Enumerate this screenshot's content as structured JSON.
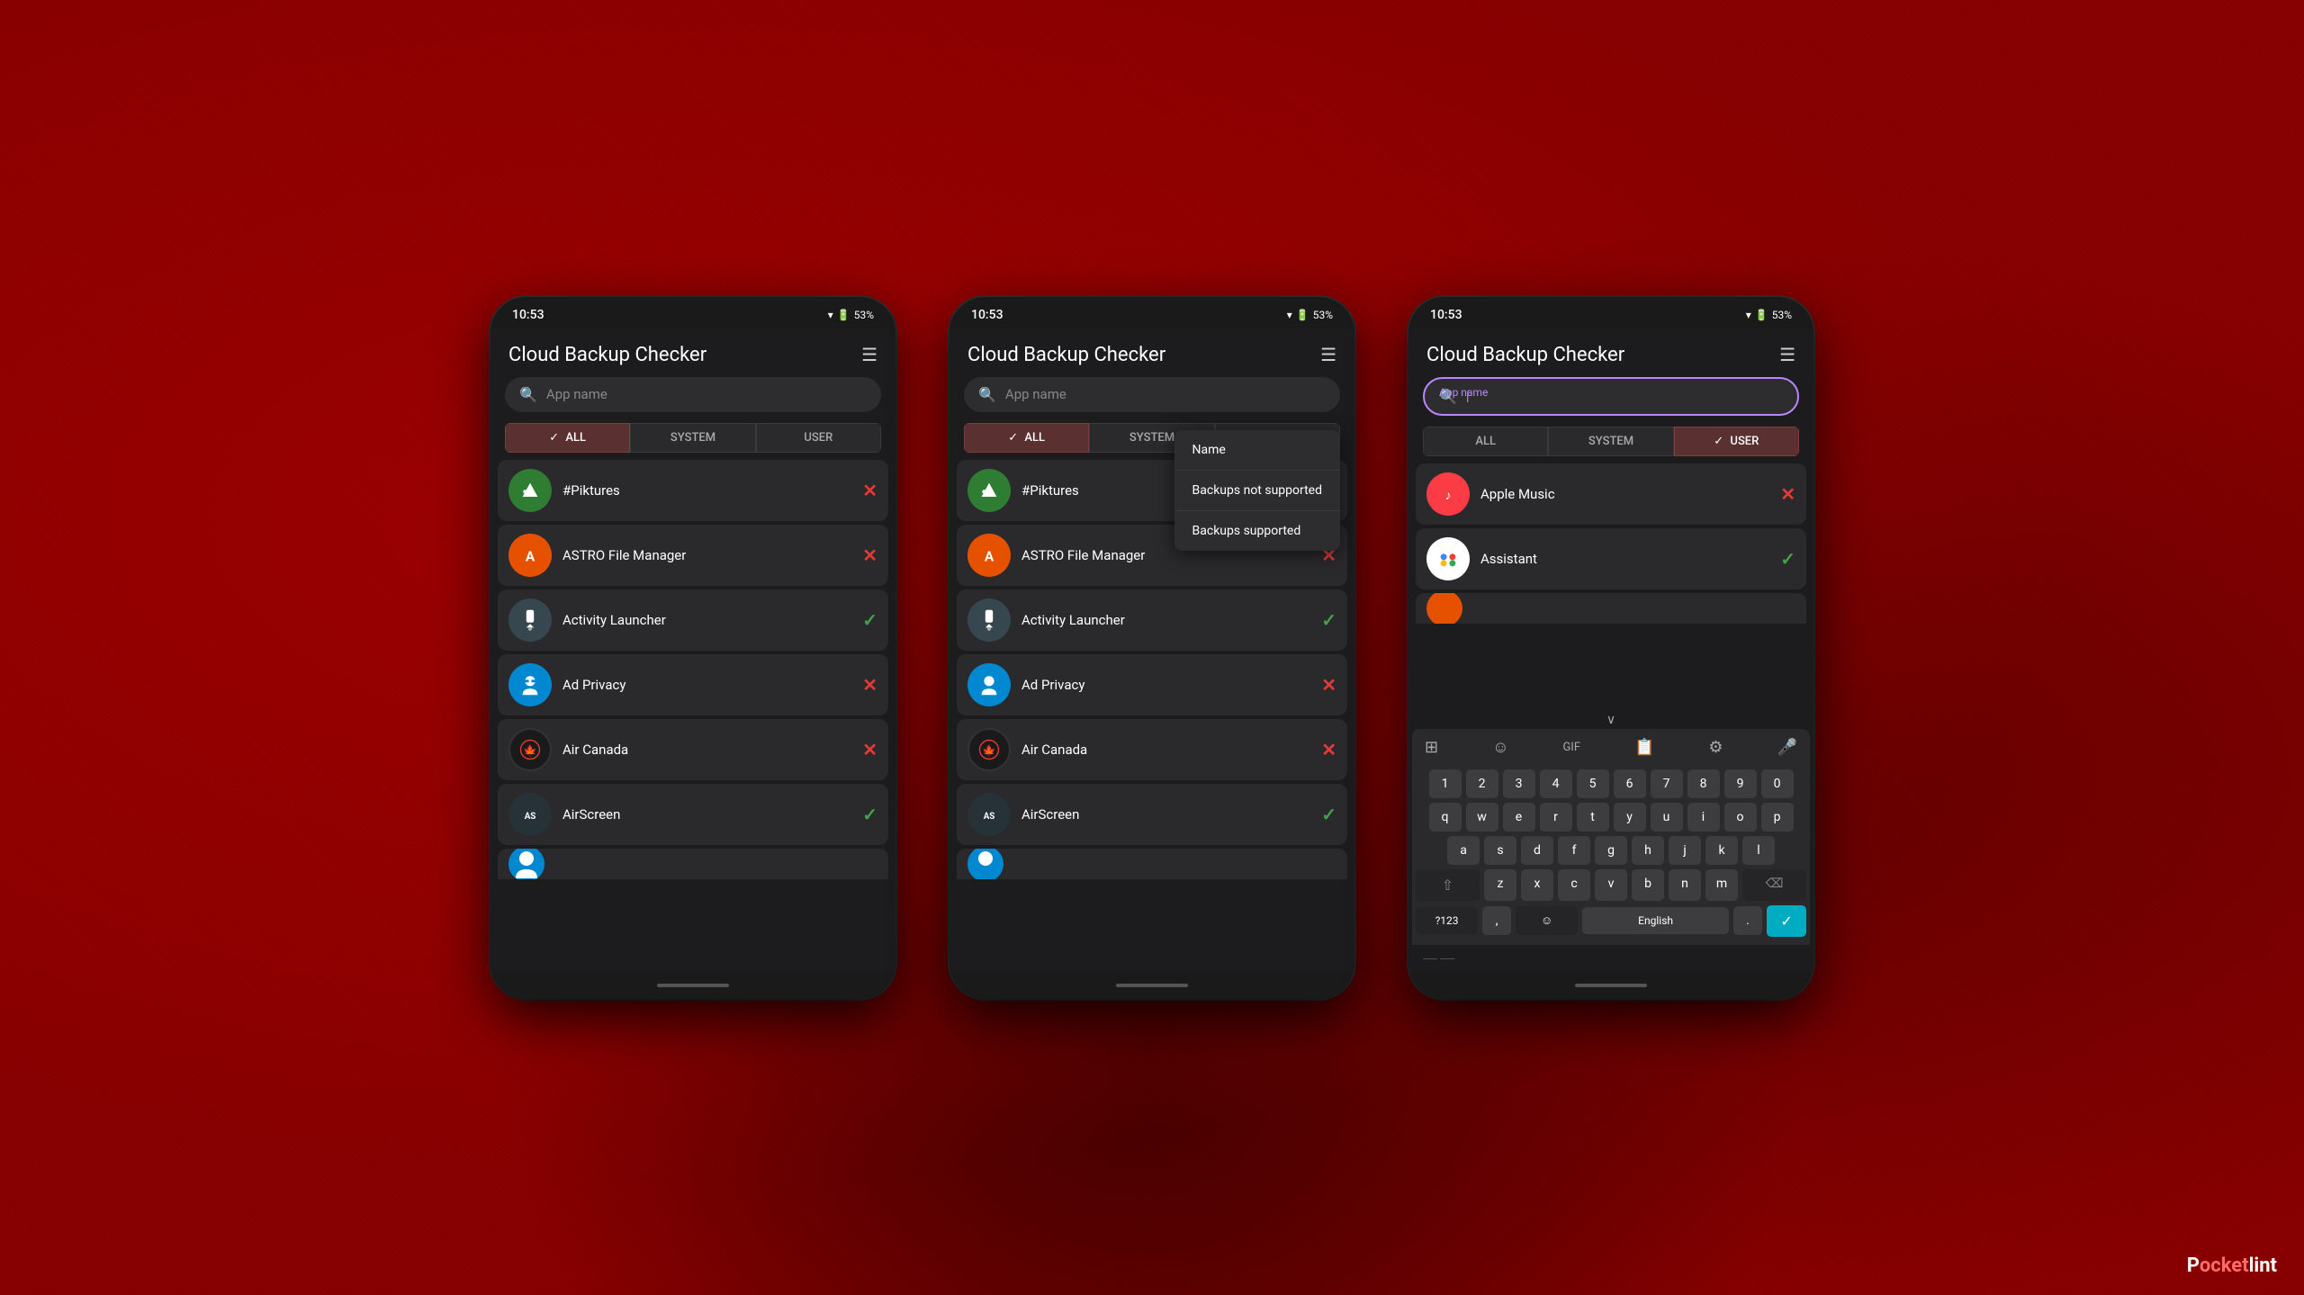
{
  "background": {
    "color": "#8b0000"
  },
  "phones": [
    {
      "id": "phone1",
      "status_bar": {
        "time": "10:53",
        "battery": "53%",
        "wifi": "▼"
      },
      "header": {
        "title": "Cloud Backup Checker",
        "filter_icon": "≡"
      },
      "search": {
        "placeholder": "App name",
        "active": false
      },
      "tabs": [
        {
          "label": "ALL",
          "active": true,
          "has_check": true
        },
        {
          "label": "SYSTEM",
          "active": false,
          "has_check": false
        },
        {
          "label": "USER",
          "active": false,
          "has_check": false
        }
      ],
      "apps": [
        {
          "name": "#Piktures",
          "icon_class": "icon-piktures",
          "icon_text": "🏔",
          "status": "x"
        },
        {
          "name": "ASTRO File Manager",
          "icon_class": "icon-astro",
          "icon_text": "A",
          "status": "x"
        },
        {
          "name": "Activity Launcher",
          "icon_class": "icon-activity",
          "icon_text": "🚀",
          "status": "check"
        },
        {
          "name": "Ad Privacy",
          "icon_class": "icon-adprivacy",
          "icon_text": "🤖",
          "status": "x"
        },
        {
          "name": "Air Canada",
          "icon_class": "icon-aircanada",
          "icon_text": "✈",
          "status": "x"
        },
        {
          "name": "AirScreen",
          "icon_class": "icon-airscreen",
          "icon_text": "AS",
          "status": "check"
        }
      ],
      "partial_app": {
        "icon_class": "icon-adprivacy",
        "icon_text": "🤖"
      }
    },
    {
      "id": "phone2",
      "status_bar": {
        "time": "10:53",
        "battery": "53%"
      },
      "header": {
        "title": "Cloud Backup Checker",
        "filter_icon": "≡"
      },
      "search": {
        "placeholder": "App name",
        "active": false
      },
      "tabs": [
        {
          "label": "ALL",
          "active": true,
          "has_check": true
        },
        {
          "label": "SYSTEM",
          "active": false,
          "has_check": false
        },
        {
          "label": "USER",
          "active": false,
          "has_check": false
        }
      ],
      "dropdown": {
        "items": [
          "Name",
          "Backups not supported",
          "Backups supported"
        ]
      },
      "apps": [
        {
          "name": "#Piktures",
          "icon_class": "icon-piktures",
          "icon_text": "🏔",
          "status": "x"
        },
        {
          "name": "ASTRO File Manager",
          "icon_class": "icon-astro",
          "icon_text": "A",
          "status": "x"
        },
        {
          "name": "Activity Launcher",
          "icon_class": "icon-activity",
          "icon_text": "🚀",
          "status": "check"
        },
        {
          "name": "Ad Privacy",
          "icon_class": "icon-adprivacy",
          "icon_text": "🤖",
          "status": "x"
        },
        {
          "name": "Air Canada",
          "icon_class": "icon-aircanada",
          "icon_text": "✈",
          "status": "x"
        },
        {
          "name": "AirScreen",
          "icon_class": "icon-airscreen",
          "icon_text": "AS",
          "status": "check"
        }
      ],
      "partial_app": {
        "icon_class": "icon-adprivacy",
        "icon_text": "🤖"
      }
    },
    {
      "id": "phone3",
      "status_bar": {
        "time": "10:53",
        "battery": "53%"
      },
      "header": {
        "title": "Cloud Backup Checker",
        "filter_icon": "≡"
      },
      "search": {
        "placeholder": "App name",
        "active": true,
        "cursor": "|"
      },
      "tabs": [
        {
          "label": "ALL",
          "active": false,
          "has_check": false
        },
        {
          "label": "SYSTEM",
          "active": false,
          "has_check": false
        },
        {
          "label": "USER",
          "active": true,
          "has_check": true
        }
      ],
      "apps": [
        {
          "name": "Apple Music",
          "icon_class": "icon-applemusic",
          "icon_text": "♪",
          "status": "x"
        },
        {
          "name": "Assistant",
          "icon_class": "icon-assistant",
          "icon_text": "●",
          "status": "check"
        }
      ],
      "partial_app": {
        "icon_class": "icon-astro",
        "icon_text": "A"
      },
      "keyboard": {
        "toolbar": [
          "⊞",
          "☺",
          "GIF",
          "📋",
          "⚙",
          "🎤"
        ],
        "rows": [
          [
            "1",
            "2",
            "3",
            "4",
            "5",
            "6",
            "7",
            "8",
            "9",
            "0"
          ],
          [
            "q",
            "w",
            "e",
            "r",
            "t",
            "y",
            "u",
            "i",
            "o",
            "p"
          ],
          [
            "a",
            "s",
            "d",
            "f",
            "g",
            "h",
            "j",
            "k",
            "l"
          ],
          [
            "⇧",
            "z",
            "x",
            "c",
            "v",
            "b",
            "n",
            "m",
            "⌫"
          ],
          [
            "?123",
            ",",
            "☺",
            "English",
            ".",
            "✓"
          ]
        ]
      }
    }
  ],
  "branding": {
    "pocket": "P",
    "name_part1": "ocket",
    "name_part2": "lint"
  }
}
